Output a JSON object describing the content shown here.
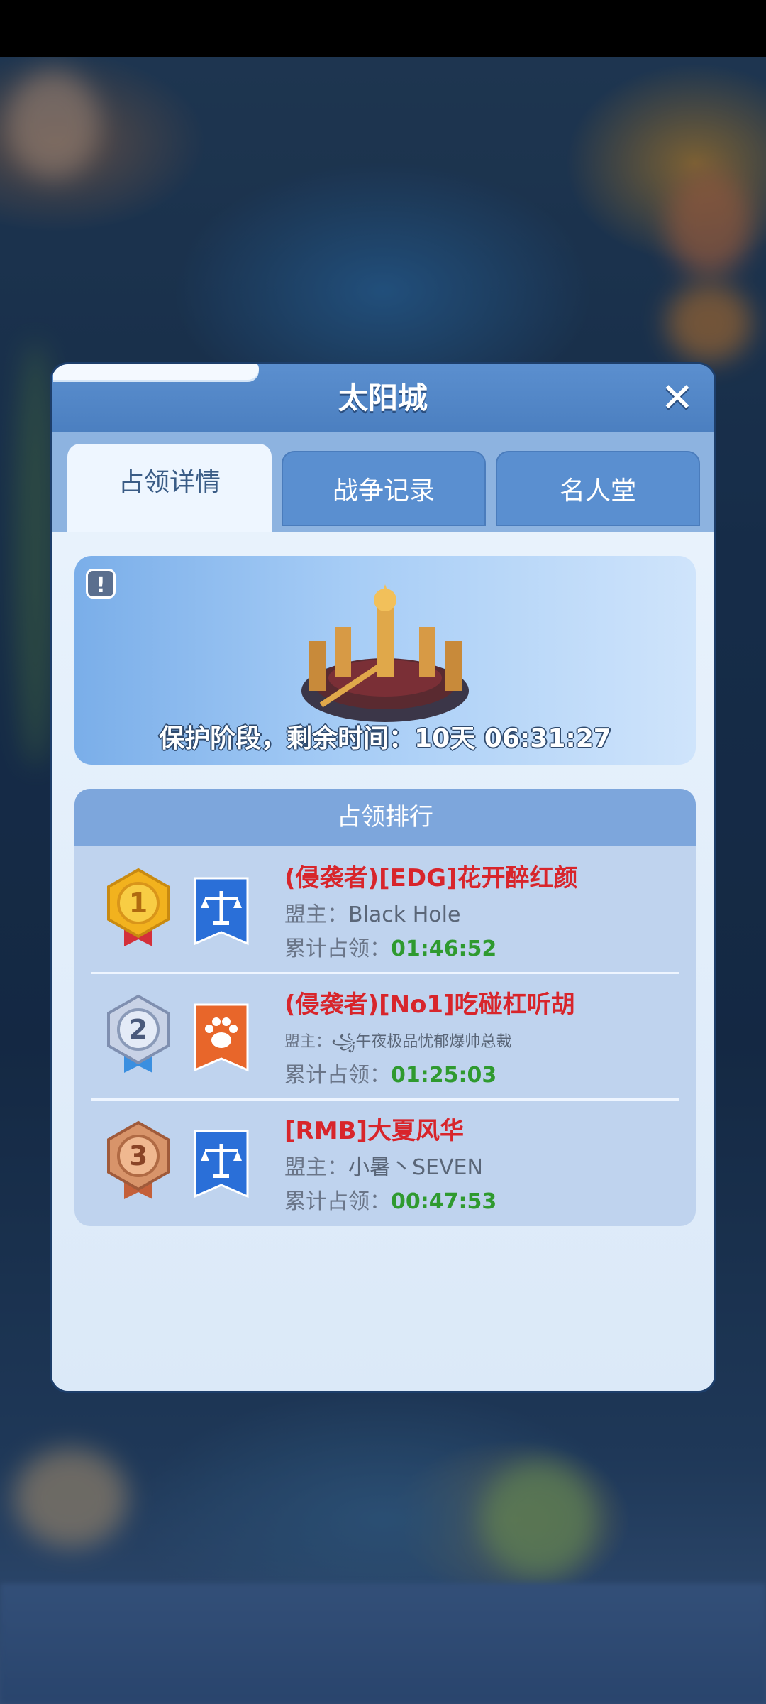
{
  "dialog": {
    "title": "太阳城",
    "close_icon": "close-x-icon"
  },
  "tabs": [
    {
      "label": "占领详情",
      "active": true
    },
    {
      "label": "战争记录",
      "active": false
    },
    {
      "label": "名人堂",
      "active": false
    }
  ],
  "banner": {
    "info_icon": "exclamation-icon",
    "building_icon": "sun-city-building-icon",
    "protection_text": "保护阶段，剩余时间：10天 06:31:27"
  },
  "ranking": {
    "header": "占领排行",
    "leader_label": "盟主：",
    "time_label": "累计占领：",
    "rows": [
      {
        "rank": "1",
        "medal": "gold-medal-icon",
        "flag": "blue-scales-flag-icon",
        "name": "(侵袭者)[EDG]花开醉红颜",
        "leader": "Black Hole",
        "time": "01:46:52"
      },
      {
        "rank": "2",
        "medal": "silver-medal-icon",
        "flag": "orange-paw-flag-icon",
        "name": "(侵袭者)[No1]吃碰杠听胡",
        "leader": "꧁午夜极品忧郁爆帅总裁",
        "time": "01:25:03"
      },
      {
        "rank": "3",
        "medal": "bronze-medal-icon",
        "flag": "blue-scales-flag-icon",
        "name": "[RMB]大夏风华",
        "leader": "小暑丶SEVEN",
        "time": "00:47:53"
      }
    ]
  },
  "colors": {
    "header_blue": "#4b7fc0",
    "name_red": "#d8252b",
    "time_green": "#2f9a2f"
  }
}
